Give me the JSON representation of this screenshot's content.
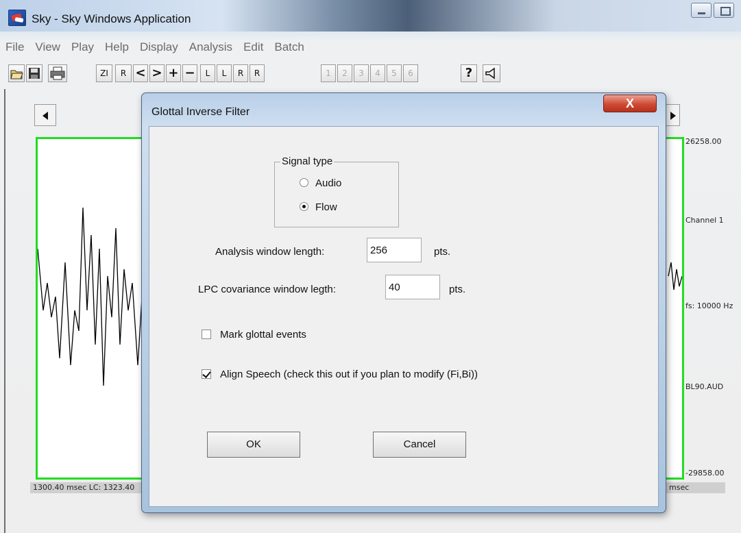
{
  "window": {
    "title": "Sky - Sky Windows Application"
  },
  "menu": [
    "File",
    "View",
    "Play",
    "Help",
    "Display",
    "Analysis",
    "Edit",
    "Batch"
  ],
  "toolbar": {
    "zi": "ZI",
    "r": "R",
    "prev": "<",
    "next": ">",
    "plus": "+",
    "minus": "−",
    "lb1": "L",
    "lb2": "L",
    "rb1": "R",
    "rb2": "R",
    "n1": "1",
    "n2": "2",
    "n3": "3",
    "n4": "4",
    "n5": "5",
    "n6": "6",
    "help": "?"
  },
  "plot": {
    "max_value": "26258.00",
    "channel": "Channel 1",
    "sample_rate": "fs: 10000 Hz",
    "filename": "BL90.AUD",
    "min_value": "-29858.00",
    "status_left": "1300.40 msec  LC: 1323.40",
    "status_right": "msec",
    "trace_color": "#000000",
    "frame_color": "#22dd22"
  },
  "dialog": {
    "title": "Glottal Inverse Filter",
    "close_label": "X",
    "signal_type": {
      "legend": "Signal type",
      "options": [
        "Audio",
        "Flow"
      ],
      "selected": "Flow"
    },
    "analysis_window": {
      "label": "Analysis window length:",
      "value": "256",
      "unit": "pts."
    },
    "lpc_window": {
      "label": "LPC covariance window legth:",
      "value": "40",
      "unit": "pts."
    },
    "mark_glottal": {
      "label": "Mark glottal events",
      "checked": false
    },
    "align_speech": {
      "label": "Align Speech (check this out if you plan to modify (Fi,Bi))",
      "checked": true
    },
    "ok_label": "OK",
    "cancel_label": "Cancel"
  }
}
